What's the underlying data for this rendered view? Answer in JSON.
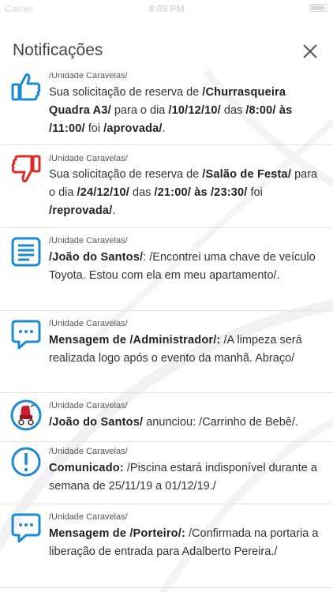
{
  "status_bar": {
    "carrier": "Carrier",
    "time": "8:09 PM"
  },
  "header": {
    "title": "Notificações"
  },
  "icons": {
    "approved": "thumbs-up-icon",
    "rejected": "thumbs-down-icon",
    "message_doc": "document-icon",
    "chat": "chat-bubble-icon",
    "product": "stroller-avatar-icon",
    "announcement": "exclamation-icon",
    "close": "close-icon"
  },
  "colors": {
    "blue": "#1a8ad1",
    "red": "#e02a2a"
  },
  "notifications": [
    {
      "unit": "/Unidade Caravelas/",
      "parts": [
        {
          "t": "Sua solicitação de reserva de "
        },
        {
          "b": "/Churrasqueira Quadra A3/"
        },
        {
          "t": " para o dia "
        },
        {
          "b": "/10/12/10/"
        },
        {
          "t": " das "
        },
        {
          "b": "/8:00/ às /11:00/"
        },
        {
          "t": " foi "
        },
        {
          "b": "/aprovada/"
        },
        {
          "t": "."
        }
      ]
    },
    {
      "unit": "/Unidade Caravelas/",
      "parts": [
        {
          "t": "Sua solicitação de reserva de "
        },
        {
          "b": "/Salão de Festa/"
        },
        {
          "t": " para o dia "
        },
        {
          "b": "/24/12/10/"
        },
        {
          "t": " das "
        },
        {
          "b": "/21:00/ às /23:30/"
        },
        {
          "t": " foi "
        },
        {
          "b": "/reprovada/"
        },
        {
          "t": "."
        }
      ]
    },
    {
      "unit": "/Unidade Caravelas/",
      "parts": [
        {
          "b": "/João do Santos/"
        },
        {
          "t": ": /Encontrei uma chave de veículo Toyota. Estou com ela em meu apartamento/."
        }
      ]
    },
    {
      "unit": "/Unidade Caravelas/",
      "parts": [
        {
          "b": "Mensagem de /Administrador/:"
        },
        {
          "t": " /A limpeza será realizada logo após o evento da manhã. Abraço/"
        }
      ]
    },
    {
      "unit": "/Unidade Caravelas/",
      "parts": [
        {
          "b": "/João do Santos/"
        },
        {
          "t": " anunciou: /Carrinho de Bebê/."
        }
      ]
    },
    {
      "unit": "/Unidade Caravelas/",
      "parts": [
        {
          "b": "Comunicado:"
        },
        {
          "t": " /Piscina estará indisponível durante a semana de 25/11/19 a 01/12/19./"
        }
      ]
    },
    {
      "unit": "/Unidade Caravelas/",
      "parts": [
        {
          "b": "Mensagem de /Porteiro/:"
        },
        {
          "t": " /Confirmada na portaria a liberação de entrada para Adalberto Pereira./"
        }
      ]
    }
  ]
}
